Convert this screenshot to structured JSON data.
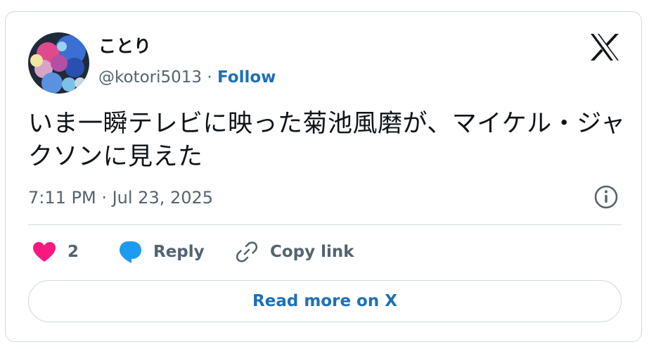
{
  "author": {
    "display_name": "ことり",
    "handle": "@kotori5013",
    "separator": " · ",
    "follow_label": "Follow"
  },
  "tweet": {
    "text": "いま一瞬テレビに映った菊池風磨が、マイケル・ジャクソンに見えた",
    "timestamp": "7:11 PM · Jul 23, 2025"
  },
  "actions": {
    "like_count": "2",
    "reply_label": "Reply",
    "copy_link_label": "Copy link"
  },
  "read_more_label": "Read more on X",
  "colors": {
    "like": "#f91880",
    "reply": "#1d9bf0",
    "link": "#1d70b8",
    "secondary_text": "#536471",
    "border": "#cfd9de"
  }
}
